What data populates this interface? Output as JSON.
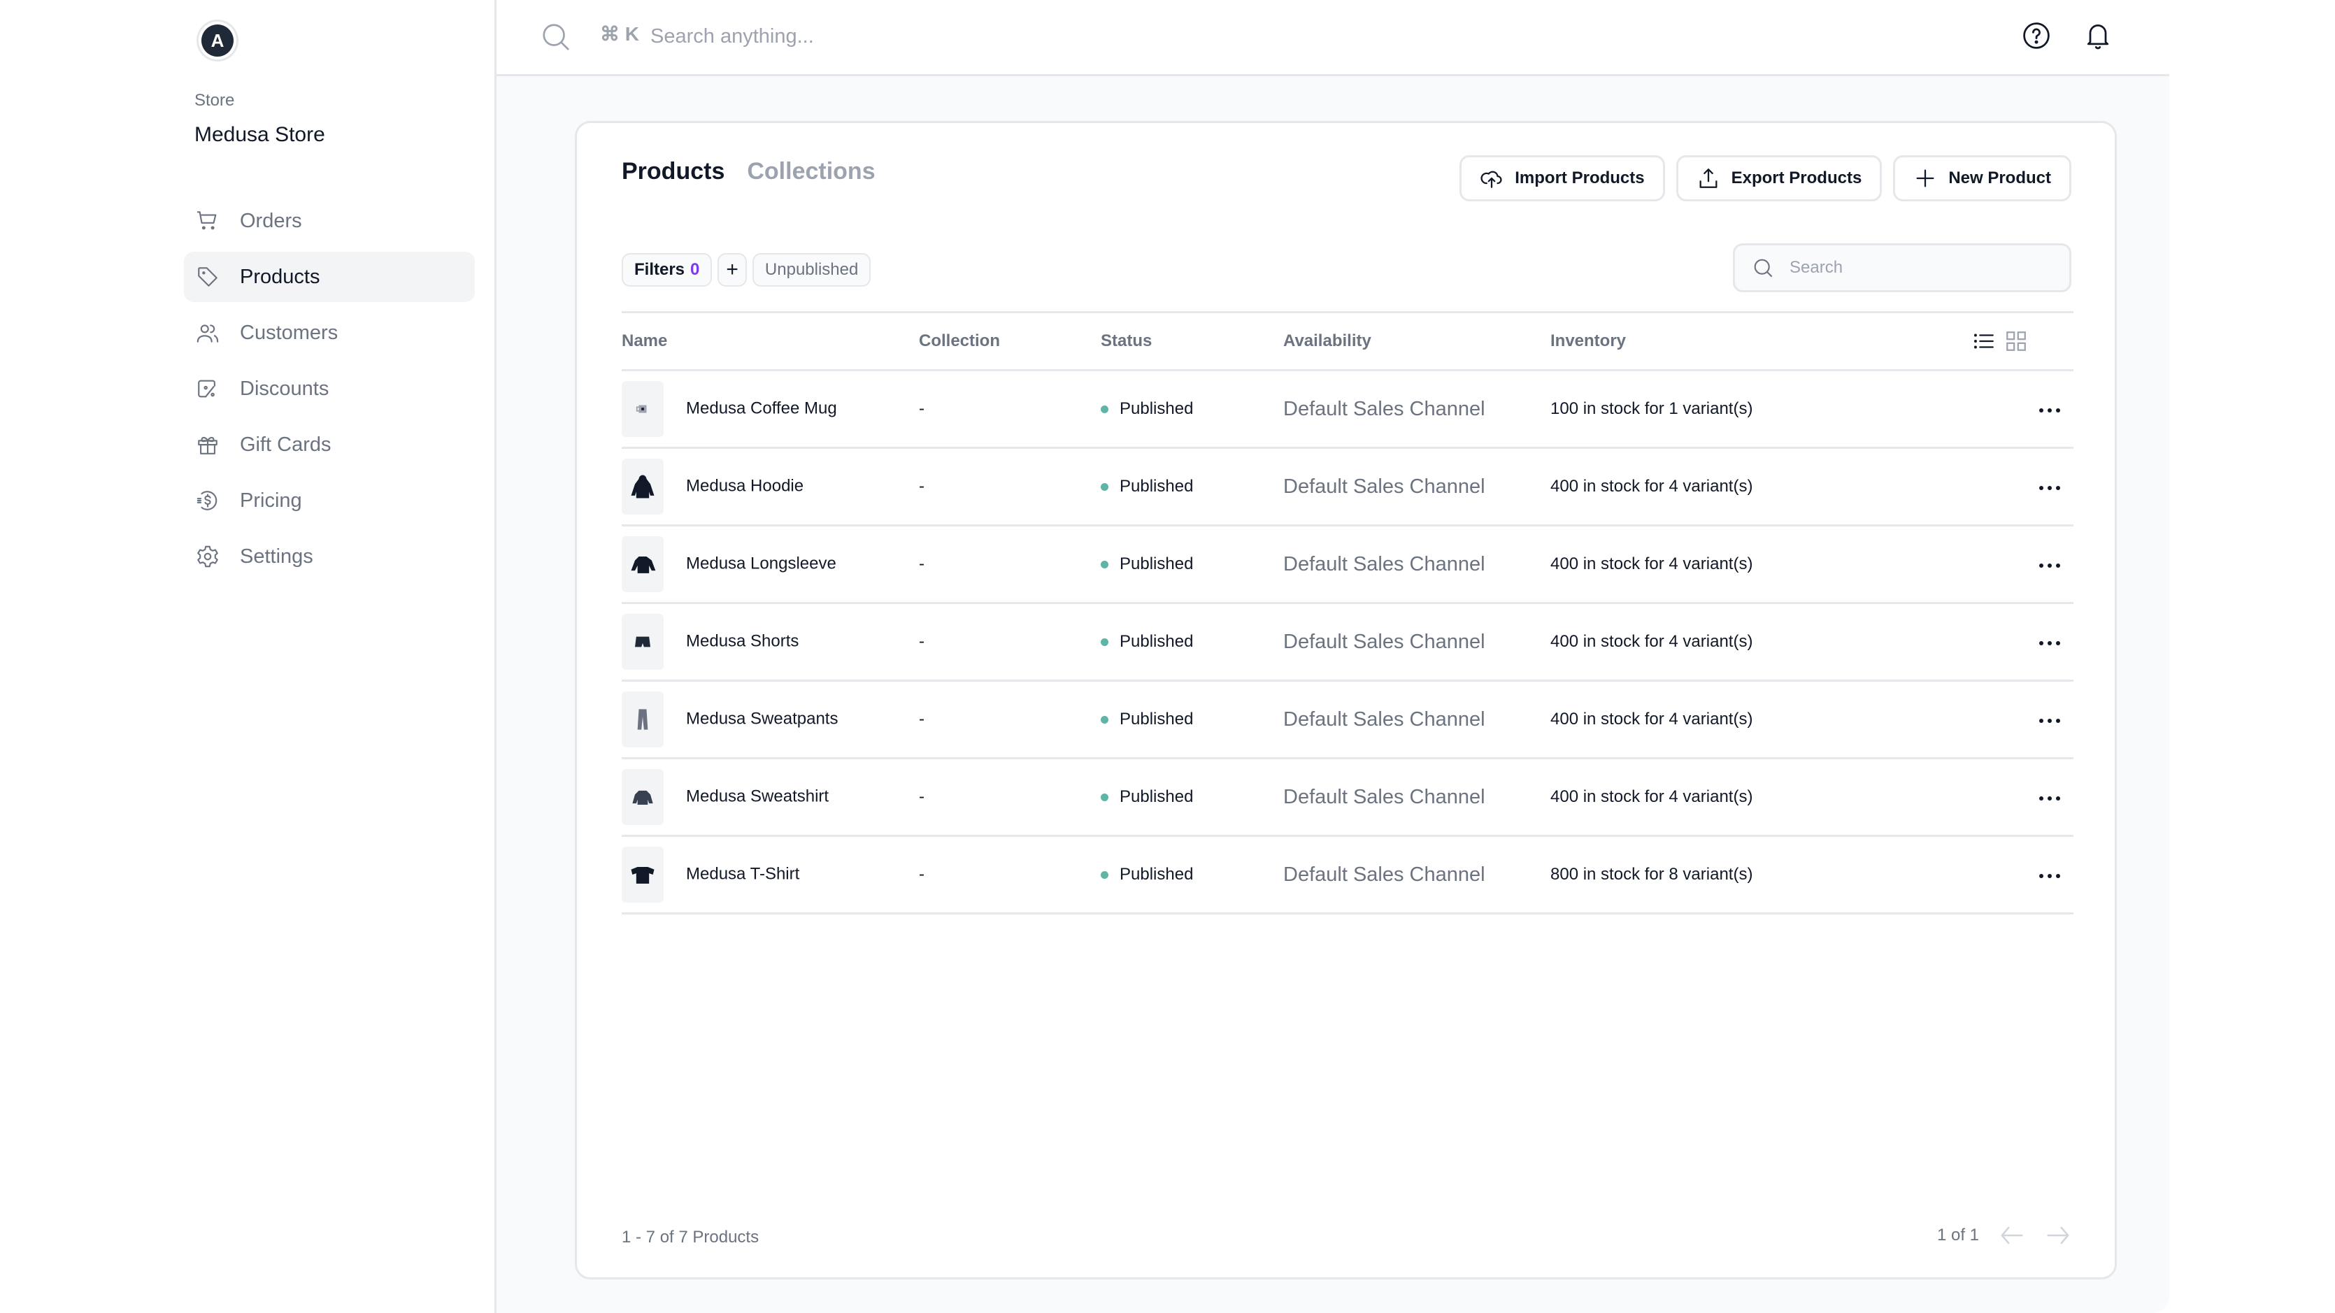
{
  "sidebar": {
    "avatar_initial": "A",
    "store_label": "Store",
    "store_name": "Medusa Store",
    "items": [
      {
        "label": "Orders",
        "icon": "cart-icon",
        "active": false
      },
      {
        "label": "Products",
        "icon": "tag-icon",
        "active": true
      },
      {
        "label": "Customers",
        "icon": "users-icon",
        "active": false
      },
      {
        "label": "Discounts",
        "icon": "discount-icon",
        "active": false
      },
      {
        "label": "Gift Cards",
        "icon": "gift-icon",
        "active": false
      },
      {
        "label": "Pricing",
        "icon": "pricing-icon",
        "active": false
      },
      {
        "label": "Settings",
        "icon": "gear-icon",
        "active": false
      }
    ]
  },
  "topbar": {
    "shortcut": "⌘ K",
    "search_placeholder": "Search anything..."
  },
  "tabs": [
    {
      "label": "Products",
      "active": true
    },
    {
      "label": "Collections",
      "active": false
    }
  ],
  "actions": {
    "import_label": "Import Products",
    "export_label": "Export Products",
    "new_label": "New Product"
  },
  "filters": {
    "label": "Filters",
    "count": "0",
    "plus": "+",
    "saved_filter": "Unpublished"
  },
  "table_search": {
    "placeholder": "Search"
  },
  "table": {
    "columns": [
      "Name",
      "Collection",
      "Status",
      "Availability",
      "Inventory"
    ],
    "status_color": "#5eb5a6",
    "rows": [
      {
        "thumb": "mug",
        "name": "Medusa Coffee Mug",
        "collection": "-",
        "status": "Published",
        "availability": "Default Sales Channel",
        "inventory": "100 in stock for 1 variant(s)"
      },
      {
        "thumb": "hoodie",
        "name": "Medusa Hoodie",
        "collection": "-",
        "status": "Published",
        "availability": "Default Sales Channel",
        "inventory": "400 in stock for 4 variant(s)"
      },
      {
        "thumb": "longsleeve",
        "name": "Medusa Longsleeve",
        "collection": "-",
        "status": "Published",
        "availability": "Default Sales Channel",
        "inventory": "400 in stock for 4 variant(s)"
      },
      {
        "thumb": "shorts",
        "name": "Medusa Shorts",
        "collection": "-",
        "status": "Published",
        "availability": "Default Sales Channel",
        "inventory": "400 in stock for 4 variant(s)"
      },
      {
        "thumb": "sweatpants",
        "name": "Medusa Sweatpants",
        "collection": "-",
        "status": "Published",
        "availability": "Default Sales Channel",
        "inventory": "400 in stock for 4 variant(s)"
      },
      {
        "thumb": "sweatshirt",
        "name": "Medusa Sweatshirt",
        "collection": "-",
        "status": "Published",
        "availability": "Default Sales Channel",
        "inventory": "400 in stock for 4 variant(s)"
      },
      {
        "thumb": "tshirt",
        "name": "Medusa T-Shirt",
        "collection": "-",
        "status": "Published",
        "availability": "Default Sales Channel",
        "inventory": "800 in stock for 8 variant(s)"
      }
    ]
  },
  "footer": {
    "count_text": "1 - 7 of 7 Products",
    "page_text": "1 of 1"
  }
}
